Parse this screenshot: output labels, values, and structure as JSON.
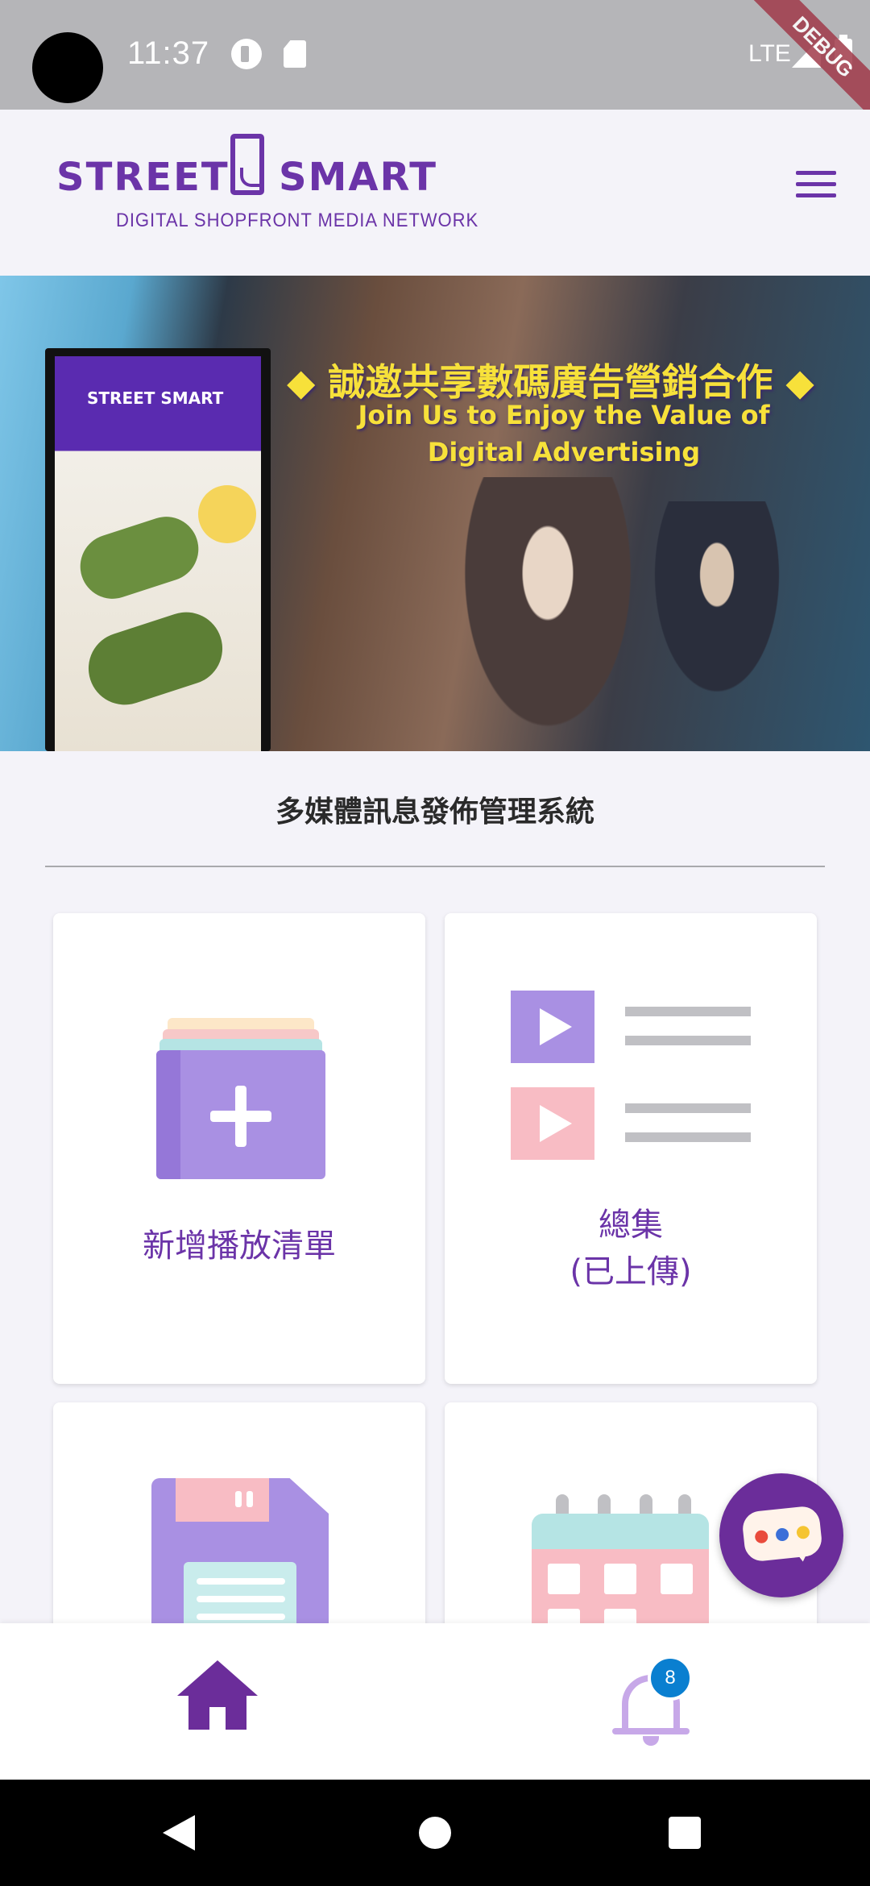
{
  "status_bar": {
    "time": "11:37",
    "network": "LTE",
    "debug_label": "DEBUG"
  },
  "header": {
    "logo_word_a": "STREET",
    "logo_word_b": "SMART",
    "logo_tagline": "DIGITAL SHOPFRONT MEDIA NETWORK",
    "menu_icon": "hamburger-menu-icon"
  },
  "banner": {
    "headline_cn": "◆ 誠邀共享數碼廣告營銷合作 ◆",
    "headline_en": "Join Us to Enjoy the Value of Digital Advertising",
    "screen_logo": "STREET SMART"
  },
  "main": {
    "section_title": "多媒體訊息發佈管理系統",
    "cards": [
      {
        "label": "新增播放清單",
        "icon": "folder-add-icon"
      },
      {
        "label": "總集\n(已上傳)",
        "icon": "video-playlist-icon"
      },
      {
        "label": "",
        "icon": "floppy-disk-icon"
      },
      {
        "label": "",
        "icon": "calendar-clock-icon"
      }
    ]
  },
  "chat_fab": {
    "icon": "chat-bubble-icon",
    "dot_colors": [
      "#e94b3c",
      "#3b6fd8",
      "#f5c431"
    ]
  },
  "bottom_nav": {
    "home_icon": "home-icon",
    "notifications_icon": "bell-icon",
    "notification_count": "8"
  },
  "colors": {
    "brand_purple": "#6b34a8",
    "accent_lavender": "#a990e3",
    "badge_blue": "#0a7fd0"
  }
}
